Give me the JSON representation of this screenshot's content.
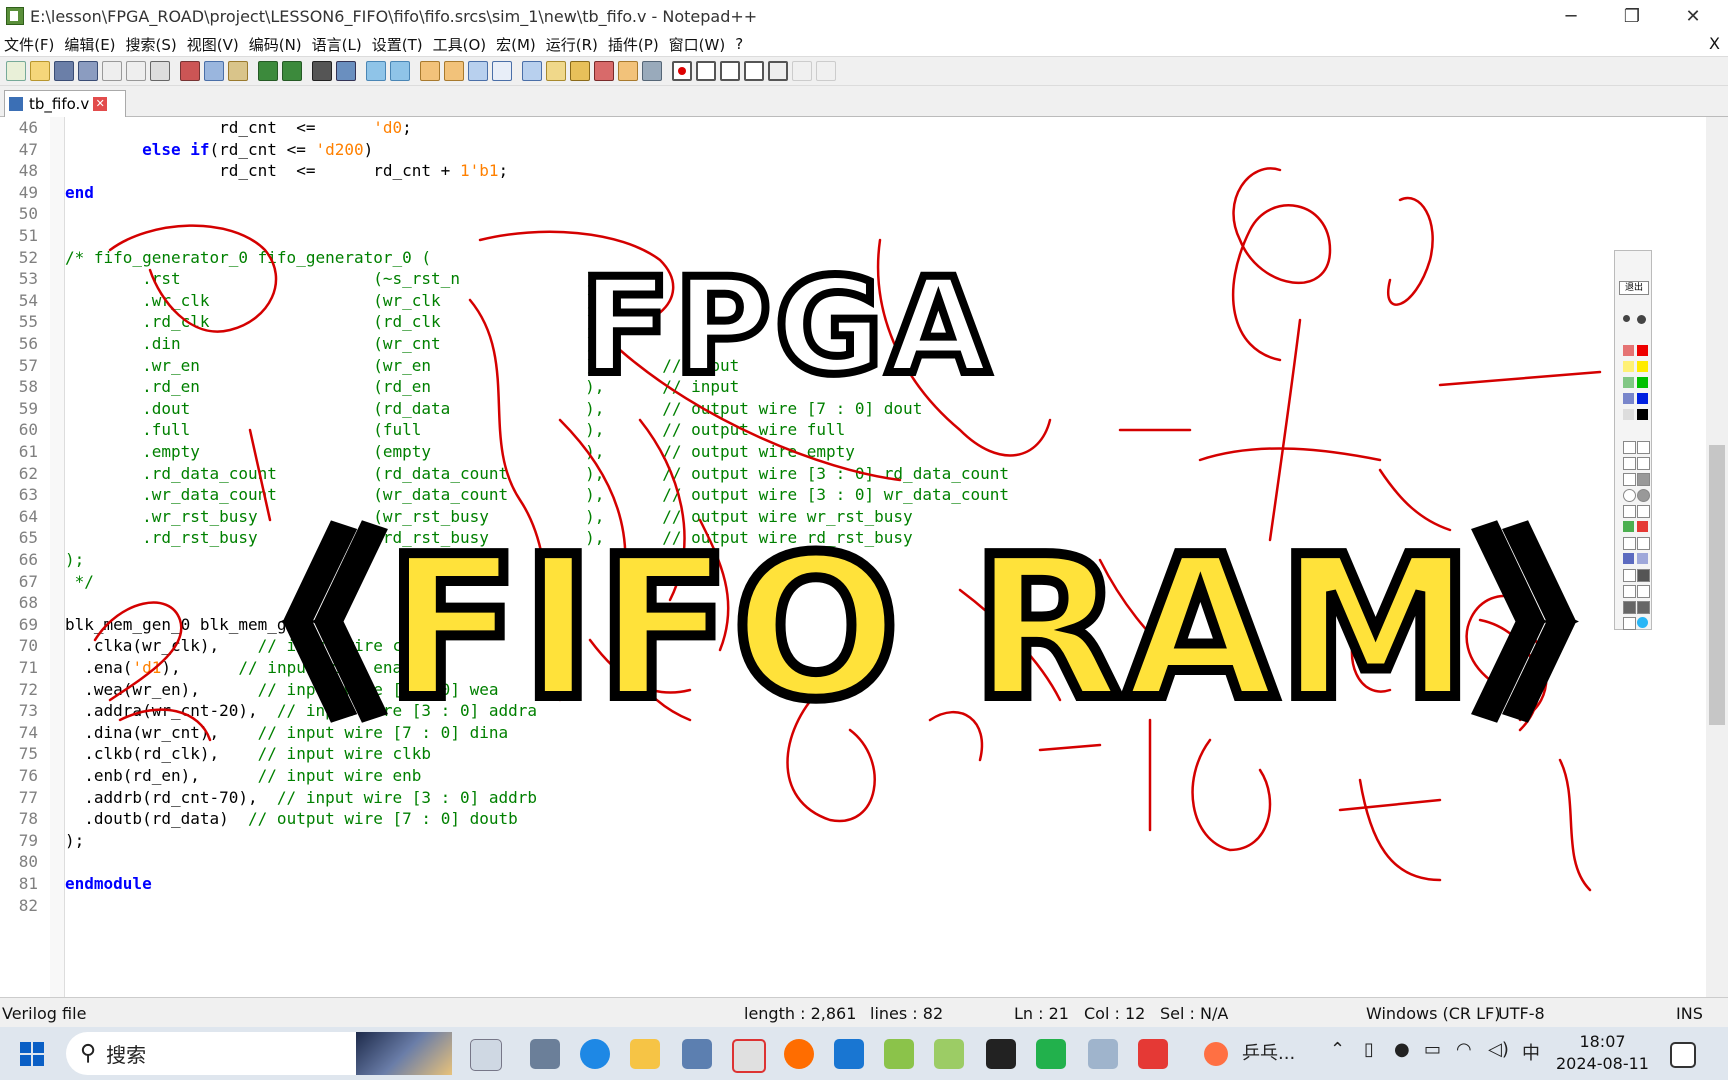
{
  "window": {
    "title": "E:\\lesson\\FPGA_ROAD\\project\\LESSON6_FIFO\\fifo\\fifo.srcs\\sim_1\\new\\tb_fifo.v - Notepad++",
    "minimize": "─",
    "restore": "❐",
    "close": "✕"
  },
  "menu": {
    "items": [
      "文件(F)",
      "编辑(E)",
      "搜索(S)",
      "视图(V)",
      "编码(N)",
      "语言(L)",
      "设置(T)",
      "工具(O)",
      "宏(M)",
      "运行(R)",
      "插件(P)",
      "窗口(W)",
      "?"
    ],
    "close_doc": "X"
  },
  "tab": {
    "label": "tb_fifo.v",
    "close": "✕"
  },
  "code": [
    {
      "n": "46",
      "t": "                rd_cnt  <=      'd0;"
    },
    {
      "n": "47",
      "t": "        else if(rd_cnt <= 'd200)"
    },
    {
      "n": "48",
      "t": "                rd_cnt  <=      rd_cnt + 1'b1;"
    },
    {
      "n": "49",
      "t": "end"
    },
    {
      "n": "50",
      "t": ""
    },
    {
      "n": "51",
      "t": ""
    },
    {
      "n": "52",
      "t": "/* fifo_generator_0 fifo_generator_0 ("
    },
    {
      "n": "53",
      "t": "        .rst                    (~s_rst_n             ),"
    },
    {
      "n": "54",
      "t": "        .wr_clk                 (wr_clk               ),"
    },
    {
      "n": "55",
      "t": "        .rd_clk                 (rd_clk               ),"
    },
    {
      "n": "56",
      "t": "        .din                    (wr_cnt               ),"
    },
    {
      "n": "57",
      "t": "        .wr_en                  (wr_en                ),      // input"
    },
    {
      "n": "58",
      "t": "        .rd_en                  (rd_en                ),      // input"
    },
    {
      "n": "59",
      "t": "        .dout                   (rd_data              ),      // output wire [7 : 0] dout"
    },
    {
      "n": "60",
      "t": "        .full                   (full                 ),      // output wire full"
    },
    {
      "n": "61",
      "t": "        .empty                  (empty                ),      // output wire empty"
    },
    {
      "n": "62",
      "t": "        .rd_data_count          (rd_data_count        ),      // output wire [3 : 0] rd_data_count"
    },
    {
      "n": "63",
      "t": "        .wr_data_count          (wr_data_count        ),      // output wire [3 : 0] wr_data_count"
    },
    {
      "n": "64",
      "t": "        .wr_rst_busy            (wr_rst_busy          ),      // output wire wr_rst_busy"
    },
    {
      "n": "65",
      "t": "        .rd_rst_busy            (rd_rst_busy          ),      // output wire rd_rst_busy"
    },
    {
      "n": "66",
      "t": ");"
    },
    {
      "n": "67",
      "t": " */"
    },
    {
      "n": "68",
      "t": ""
    },
    {
      "n": "69",
      "t": "blk_mem_gen_0 blk_mem_gen_0 ("
    },
    {
      "n": "70",
      "t": "  .clka(wr_clk),    // input wire clka"
    },
    {
      "n": "71",
      "t": "  .ena('d1),      // input wire ena"
    },
    {
      "n": "72",
      "t": "  .wea(wr_en),      // input wire [0 : 0] wea"
    },
    {
      "n": "73",
      "t": "  .addra(wr_cnt-20),  // input wire [3 : 0] addra"
    },
    {
      "n": "74",
      "t": "  .dina(wr_cnt),    // input wire [7 : 0] dina"
    },
    {
      "n": "75",
      "t": "  .clkb(rd_clk),    // input wire clkb"
    },
    {
      "n": "76",
      "t": "  .enb(rd_en),      // input wire enb"
    },
    {
      "n": "77",
      "t": "  .addrb(rd_cnt-70),  // input wire [3 : 0] addrb"
    },
    {
      "n": "78",
      "t": "  .doutb(rd_data)  // output wire [7 : 0] doutb"
    },
    {
      "n": "79",
      "t": ");"
    },
    {
      "n": "80",
      "t": ""
    },
    {
      "n": "81",
      "t": "endmodule"
    },
    {
      "n": "82",
      "t": ""
    }
  ],
  "status": {
    "filetype": "Verilog file",
    "length": "length : 2,861",
    "lines": "lines : 82",
    "ln": "Ln : 21",
    "col": "Col : 12",
    "sel": "Sel : N/A",
    "eol": "Windows (CR LF)",
    "enc": "UTF-8",
    "mode": "INS"
  },
  "overlay": {
    "line1": "FPGA",
    "line2": "《FIFO RAM》"
  },
  "palette": {
    "exit": "退出"
  },
  "taskbar": {
    "search": "搜索",
    "pingpong": "乒乓...",
    "ime": "中",
    "time": "18:07",
    "date": "2024-08-11"
  },
  "colors": {
    "ink": "#d40000",
    "keyword": "#0000ff",
    "number": "#ff8000",
    "comment": "#008000",
    "overlay_fill": "#ffe23a"
  }
}
